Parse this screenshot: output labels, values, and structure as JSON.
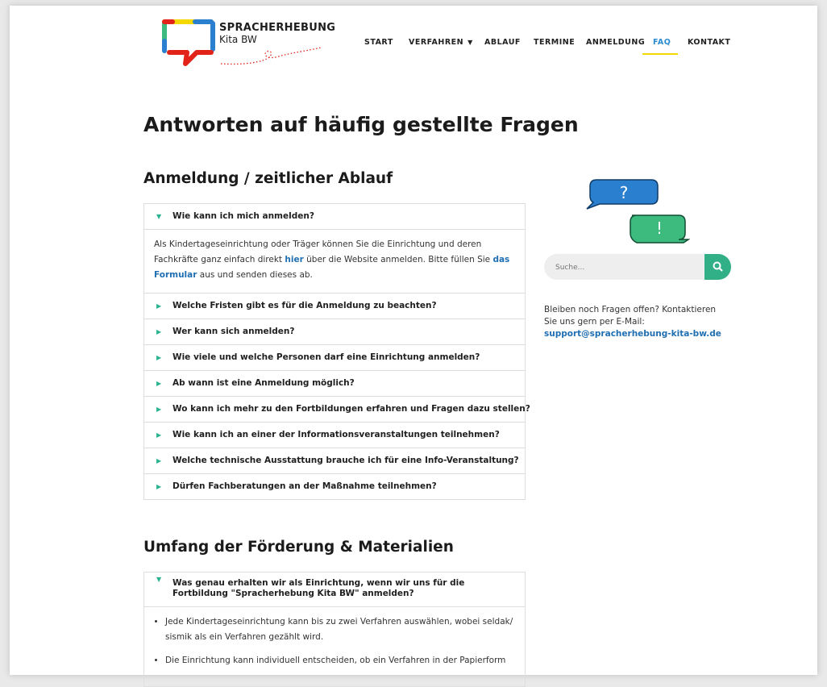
{
  "logo": {
    "line1": "SPRACHERHEBUNG",
    "line2": "Kita BW"
  },
  "nav": {
    "items": [
      {
        "label": "START"
      },
      {
        "label": "VERFAHREN"
      },
      {
        "label": "ABLAUF"
      },
      {
        "label": "TERMINE"
      },
      {
        "label": "ANMELDUNG"
      },
      {
        "label": "FAQ",
        "active": true
      },
      {
        "label": "KONTAKT"
      }
    ],
    "accent_color": "#f5d800"
  },
  "page_title": "Antworten auf häufig gestellte Fragen",
  "sections": [
    {
      "title": "Anmeldung / zeitlicher Ablauf",
      "items": [
        {
          "question": "Wie kann ich mich anmelden?",
          "expanded": true,
          "answer": {
            "text1": "Als Kindertageseinrichtung oder Träger können Sie die Einrichtung und deren Fachkräfte ganz einfach direkt ",
            "link1": "hier",
            "text2": " über die Website anmelden. Bitte füllen Sie ",
            "link2": "das Formular",
            "text3": " aus und senden dieses ab."
          }
        },
        {
          "question": "Welche Fristen gibt es für die Anmeldung zu beachten?"
        },
        {
          "question": "Wer kann sich anmelden?"
        },
        {
          "question": "Wie viele und welche Personen darf eine Einrichtung anmelden?"
        },
        {
          "question": "Ab wann ist eine Anmeldung möglich?"
        },
        {
          "question": "Wo kann ich mehr zu den Fortbildungen erfahren und Fragen dazu stellen?"
        },
        {
          "question": "Wie kann ich an einer der Informationsveranstaltungen teilnehmen?"
        },
        {
          "question": "Welche technische Ausstattung brauche ich für eine Info-Veranstaltung?"
        },
        {
          "question": "Dürfen Fachberatungen an der Maßnahme teilnehmen?"
        }
      ]
    },
    {
      "title": "Umfang der Förderung & Materialien",
      "items": [
        {
          "question": "Was genau erhalten wir als Einrichtung, wenn wir uns für die Fortbildung \"Spracherhebung Kita BW\" anmelden?",
          "expanded": true,
          "bullets": [
            "Jede Kindertageseinrichtung kann bis zu zwei Verfahren auswählen, wobei seldak/ sismik als ein Verfahren gezählt wird.",
            "Die Einrichtung kann individuell entscheiden, ob ein Verfahren in der Papierform"
          ]
        }
      ]
    }
  ],
  "sidebar": {
    "search_placeholder": "Suche...",
    "contact_text": "Bleiben noch Fragen offen? Kontaktieren Sie uns gern per E-Mail:",
    "contact_email": "support@spracherhebung-kita-bw.de"
  },
  "colors": {
    "accent_green": "#31b088",
    "link_blue": "#1f6fb2",
    "bubble_blue": "#2b7fcf",
    "bubble_green": "#3dbb7f"
  }
}
